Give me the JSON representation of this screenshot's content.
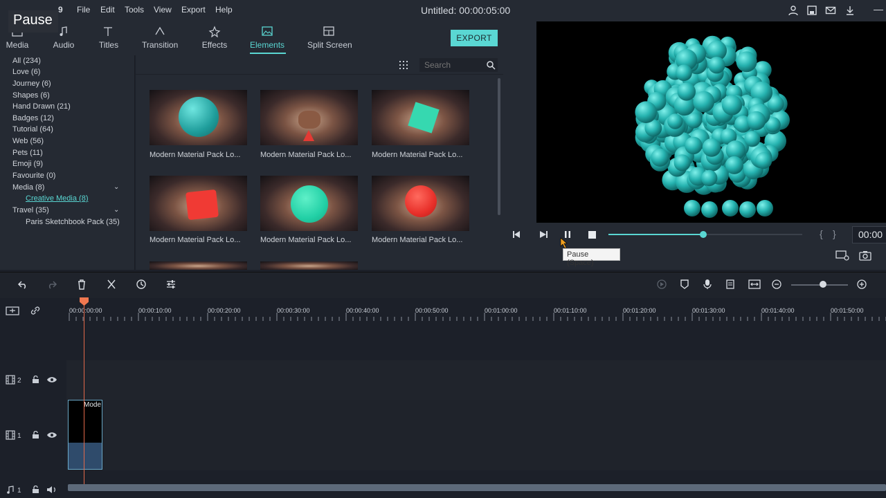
{
  "menubar": {
    "items": [
      "File",
      "Edit",
      "Tools",
      "View",
      "Export",
      "Help"
    ],
    "title": "Untitled:",
    "title_time": "00:00:05:00"
  },
  "pause_label": "Pause",
  "tabs": [
    {
      "label": "Media",
      "icon": "folder-icon"
    },
    {
      "label": "Audio",
      "icon": "music-note-icon"
    },
    {
      "label": "Titles",
      "icon": "text-icon"
    },
    {
      "label": "Transition",
      "icon": "transition-icon"
    },
    {
      "label": "Effects",
      "icon": "effects-icon"
    },
    {
      "label": "Elements",
      "icon": "image-icon",
      "active": true
    },
    {
      "label": "Split Screen",
      "icon": "split-screen-icon"
    }
  ],
  "export_label": "EXPORT",
  "categories": [
    "All (234)",
    "Love (6)",
    "Journey (6)",
    "Shapes (6)",
    "Hand Drawn (21)",
    "Badges (12)",
    "Tutorial (64)",
    "Web (56)",
    "Pets (11)",
    "Emoji (9)",
    "Favourite (0)",
    "Media (8)",
    "Creative Media (8)",
    "Travel (35)",
    "Paris Sketchbook Pack (35)"
  ],
  "search": {
    "placeholder": "Search"
  },
  "grid_items": [
    "Modern Material Pack Lo...",
    "Modern Material Pack Lo...",
    "Modern Material Pack Lo...",
    "Modern Material Pack Lo...",
    "Modern Material Pack Lo...",
    "Modern Material Pack Lo..."
  ],
  "player": {
    "timecode": "00:00",
    "tooltip": "Pause (Space)",
    "progress": 0.49
  },
  "timeline": {
    "ruler": [
      "00:00:00:00",
      "00:00:10:00",
      "00:00:20:00",
      "00:00:30:00",
      "00:00:40:00",
      "00:00:50:00",
      "00:01:00:00",
      "00:01:10:00",
      "00:01:20:00",
      "00:01:30:00",
      "00:01:40:00",
      "00:01:50:00"
    ],
    "tracks": [
      "2",
      "1",
      "1"
    ],
    "clip_label": "Mode"
  },
  "colors": {
    "accent": "#5ad7d3",
    "playhead": "#f07850"
  }
}
